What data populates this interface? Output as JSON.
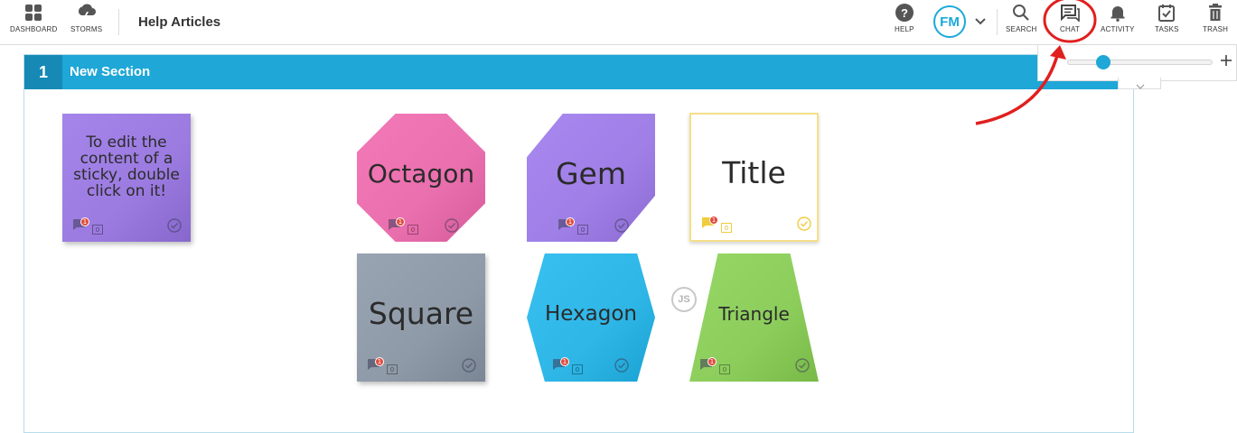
{
  "topbar": {
    "dashboard_label": "DASHBOARD",
    "storms_label": "STORMS",
    "title": "Help Articles",
    "help_label": "HELP",
    "avatar_initials": "FM",
    "search_label": "SEARCH",
    "chat_label": "CHAT",
    "activity_label": "ACTIVITY",
    "tasks_label": "TASKS",
    "trash_label": "TRASH"
  },
  "section": {
    "number": "1",
    "title": "New Section"
  },
  "stickies": [
    {
      "text": "To edit the content of a sticky, double click on it!",
      "shape": "square",
      "color": "#9b7be0",
      "comments": "1",
      "tasks": "0"
    },
    {
      "text": "Octagon",
      "shape": "octagon",
      "color": "#ea6fae",
      "comments": "1",
      "tasks": "0"
    },
    {
      "text": "Gem",
      "shape": "gem",
      "color": "#9f7fe6",
      "comments": "1",
      "tasks": "0"
    },
    {
      "text": "Title",
      "shape": "title",
      "color": "#ffffff",
      "comments": "1",
      "tasks": "0"
    },
    {
      "text": "Square",
      "shape": "square",
      "color": "#8f9aa8",
      "comments": "1",
      "tasks": "0"
    },
    {
      "text": "Hexagon",
      "shape": "hexagon",
      "color": "#2eb6e6",
      "comments": "1",
      "tasks": "0"
    },
    {
      "text": "Triangle",
      "shape": "trapezoid",
      "color": "#8ccd5c",
      "comments": "1",
      "tasks": "0"
    }
  ],
  "js_badge": "JS",
  "zoom": {
    "level": 0.24
  },
  "colors": {
    "accent": "#1ea7d7",
    "annotation": "#e0201f"
  },
  "icons": [
    "dashboard-icon",
    "storms-icon",
    "help-icon",
    "chevron-down-icon",
    "search-icon",
    "chat-icon",
    "activity-icon",
    "tasks-icon",
    "trash-icon",
    "plus-icon"
  ]
}
